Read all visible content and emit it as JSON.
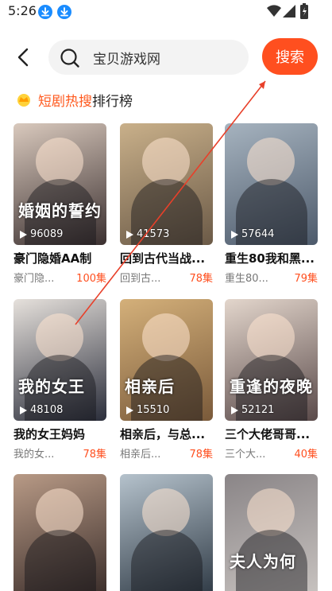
{
  "status_bar": {
    "time": "5:26"
  },
  "search": {
    "query": "宝贝游戏网",
    "button_label": "搜索"
  },
  "section": {
    "title_highlight": "短剧热搜",
    "title_rest": "排行榜"
  },
  "dramas": [
    {
      "title": "豪门隐婚AA制",
      "subtitle": "豪门隐...",
      "episodes": "100集",
      "plays": "96089",
      "poster_text": "婚姻的誓约",
      "bg": [
        "#3b3030",
        "#d9c9bd"
      ]
    },
    {
      "title": "回到古代当战...",
      "subtitle": "回到古...",
      "episodes": "78集",
      "plays": "41573",
      "poster_text": "",
      "bg": [
        "#6b5a47",
        "#c9b08a"
      ]
    },
    {
      "title": "重生80我和黑...",
      "subtitle": "重生80...",
      "episodes": "79集",
      "plays": "57644",
      "poster_text": "",
      "bg": [
        "#4d5a6b",
        "#a6b3bf"
      ]
    },
    {
      "title": "我的女王妈妈",
      "subtitle": "我的女...",
      "episodes": "78集",
      "plays": "48108",
      "poster_text": "我的女王",
      "bg": [
        "#2b2e3b",
        "#e6e1dc"
      ]
    },
    {
      "title": "相亲后，与总...",
      "subtitle": "相亲后...",
      "episodes": "78集",
      "plays": "15510",
      "poster_text": "相亲后",
      "bg": [
        "#7a5a3a",
        "#d4b07a"
      ]
    },
    {
      "title": "三个大佬哥哥...",
      "subtitle": "三个大...",
      "episodes": "40集",
      "plays": "52121",
      "poster_text": "重逢的夜晚",
      "bg": [
        "#5a4a4a",
        "#e3d6cc"
      ]
    },
    {
      "title": "",
      "subtitle": "",
      "episodes": "",
      "plays": "",
      "poster_text": "",
      "bg": [
        "#3a2d2a",
        "#b89a86"
      ]
    },
    {
      "title": "",
      "subtitle": "",
      "episodes": "",
      "plays": "",
      "poster_text": "",
      "bg": [
        "#2f3a45",
        "#b5c2cc"
      ]
    },
    {
      "title": "",
      "subtitle": "",
      "episodes": "",
      "plays": "",
      "poster_text": "夫人为何",
      "bg": [
        "#c8c3c0",
        "#8a8587"
      ]
    }
  ],
  "colors": {
    "accent": "#ff4f1f",
    "download_icon": "#1a8cff"
  },
  "icons": [
    "back-arrow-icon",
    "search-icon",
    "crown-icon",
    "play-icon",
    "download-icon",
    "wifi-icon",
    "signal-icon",
    "battery-icon"
  ]
}
